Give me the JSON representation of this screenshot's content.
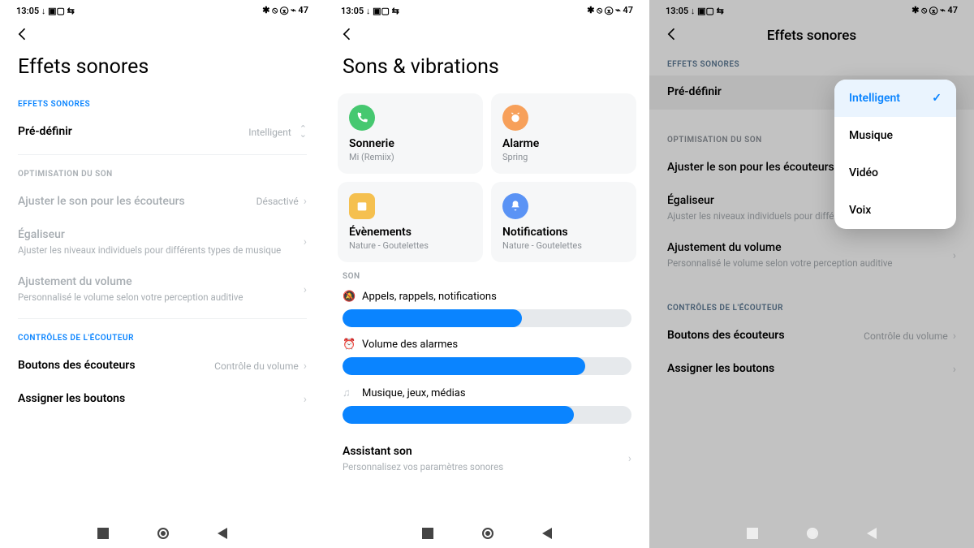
{
  "status": {
    "time": "13:05",
    "left_icons": "↓ ▣▢ ⇆",
    "right_icons": "✱ ⦸ ⓧ ⌁ 47"
  },
  "s1": {
    "title": "Effets sonores",
    "sec1": "EFFETS SONORES",
    "predef": {
      "label": "Pré-définir",
      "value": "Intelligent"
    },
    "sec2": "OPTIMISATION DU SON",
    "headphones": {
      "title": "Ajuster le son pour les écouteurs",
      "value": "Désactivé"
    },
    "eq": {
      "title": "Égaliseur",
      "sub": "Ajuster les niveaux individuels pour différents types de musique"
    },
    "vol": {
      "title": "Ajustement du volume",
      "sub": "Personnalisé le volume selon votre perception auditive"
    },
    "sec3": "CONTRÔLES DE L'ÉCOUTEUR",
    "btns": {
      "title": "Boutons des écouteurs",
      "value": "Contrôle du volume"
    },
    "assign": {
      "title": "Assigner les boutons"
    }
  },
  "s2": {
    "title": "Sons & vibrations",
    "cards": {
      "ring": {
        "title": "Sonnerie",
        "sub": "Mi (Remiix)"
      },
      "alarm": {
        "title": "Alarme",
        "sub": "Spring"
      },
      "events": {
        "title": "Évènements",
        "sub": "Nature - Goutelettes"
      },
      "notif": {
        "title": "Notifications",
        "sub": "Nature - Goutelettes"
      }
    },
    "sec_son": "SON",
    "sliders": {
      "calls": {
        "label": "Appels, rappels, notifications",
        "pct": 62
      },
      "alarms": {
        "label": "Volume des alarmes",
        "pct": 84
      },
      "media": {
        "label": "Musique, jeux, médias",
        "pct": 80
      }
    },
    "assistant": {
      "title": "Assistant son",
      "sub": "Personnalisez vos paramètres sonores"
    }
  },
  "s3": {
    "title": "Effets sonores",
    "sec1": "EFFETS SONORES",
    "predef_label": "Pré-définir",
    "sec2": "OPTIMISATION DU SON",
    "headphones": "Ajuster le son pour les écouteurs",
    "eq": {
      "title": "Égaliseur",
      "sub": "Ajuster les niveaux individuels pour différents types de musique"
    },
    "vol": {
      "title": "Ajustement du volume",
      "sub": "Personnalisé le volume selon votre perception auditive"
    },
    "sec3": "CONTRÔLES DE L'ÉCOUTEUR",
    "btns": {
      "title": "Boutons des écouteurs",
      "value": "Contrôle du volume"
    },
    "assign": "Assigner les boutons",
    "popup": {
      "opt1": "Intelligent",
      "opt2": "Musique",
      "opt3": "Vidéo",
      "opt4": "Voix"
    }
  }
}
